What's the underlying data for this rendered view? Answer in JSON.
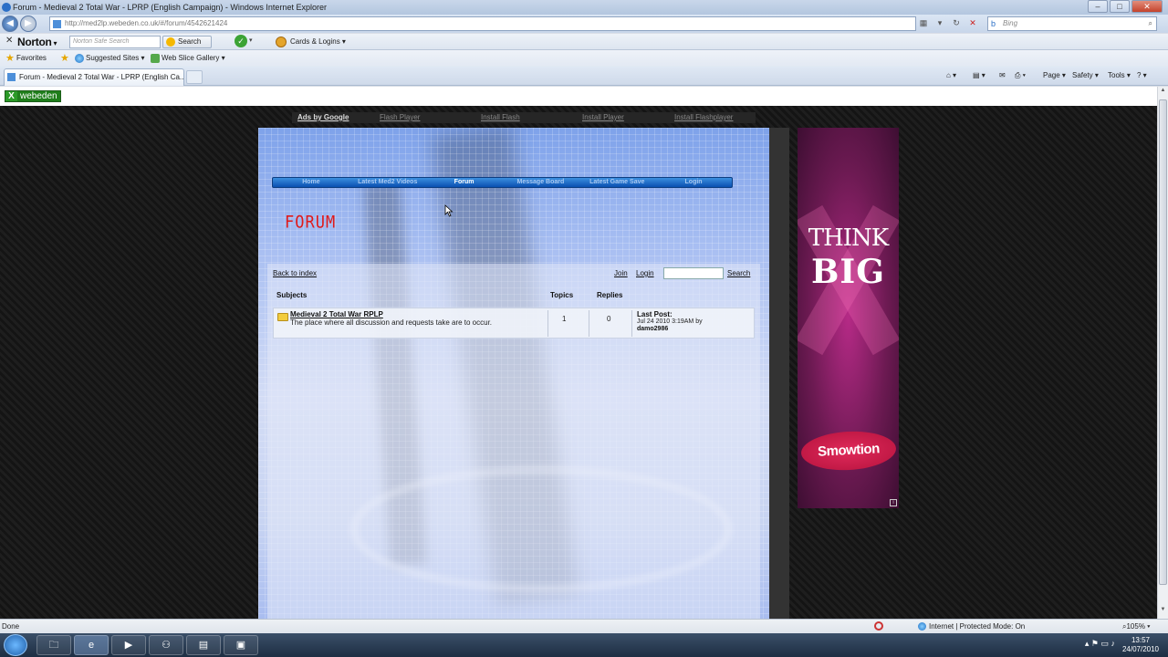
{
  "window": {
    "title": "Forum - Medieval 2 Total War - LPRP (English Campaign) - Windows Internet Explorer",
    "controls": [
      "–",
      "□",
      "✕"
    ]
  },
  "address": {
    "url": "http://med2lp.webeden.co.uk/#/forum/4542621424",
    "search_placeholder": "Bing"
  },
  "norton": {
    "logo": "Norton",
    "search_placeholder": "Norton Safe Search",
    "search_label": "Search",
    "cards_label": "Cards & Logins"
  },
  "favorites": {
    "favorites_label": "Favorites",
    "suggested_label": "Suggested Sites ▾",
    "slice_label": "Web Slice Gallery ▾"
  },
  "tab": {
    "title": "Forum - Medieval 2 Total War - LPRP (English Ca...",
    "commands": [
      "Page ▾",
      "Safety ▾",
      "Tools ▾"
    ]
  },
  "webeden": {
    "logo_mark": "X",
    "logo_text": "webeden"
  },
  "ads_bar": [
    "Ads by Google",
    "Flash Player",
    "Install Flash",
    "Install Player",
    "Install Flashplayer"
  ],
  "site_nav": [
    {
      "label": "Home",
      "active": false
    },
    {
      "label": "Latest Med2 Videos",
      "active": false
    },
    {
      "label": "Forum",
      "active": true
    },
    {
      "label": "Message Board",
      "active": false
    },
    {
      "label": "Latest Game Save",
      "active": false
    },
    {
      "label": "Login",
      "active": false
    }
  ],
  "forum": {
    "heading": "FORUM",
    "back_link": "Back to index",
    "join": "Join",
    "login": "Login",
    "search": "Search",
    "columns": {
      "subjects": "Subjects",
      "topics": "Topics",
      "replies": "Replies"
    },
    "rows": [
      {
        "title": "Medieval 2 Total War RPLP",
        "description": "The place where all discussion and requests take are to occur.",
        "topics": "1",
        "replies": "0",
        "last_post_label": "Last Post:",
        "last_post_date": "Jul 24 2010 3:19AM by",
        "last_post_user": "damo2986"
      }
    ]
  },
  "ad_banner": {
    "line1": "THINK",
    "line2": "BIG",
    "brand": "Smowtion"
  },
  "status": {
    "text": "Done",
    "zone": "Internet | Protected Mode: On",
    "zoom": "105%"
  },
  "taskbar": {
    "time": "13:57",
    "date": "24/07/2010"
  }
}
